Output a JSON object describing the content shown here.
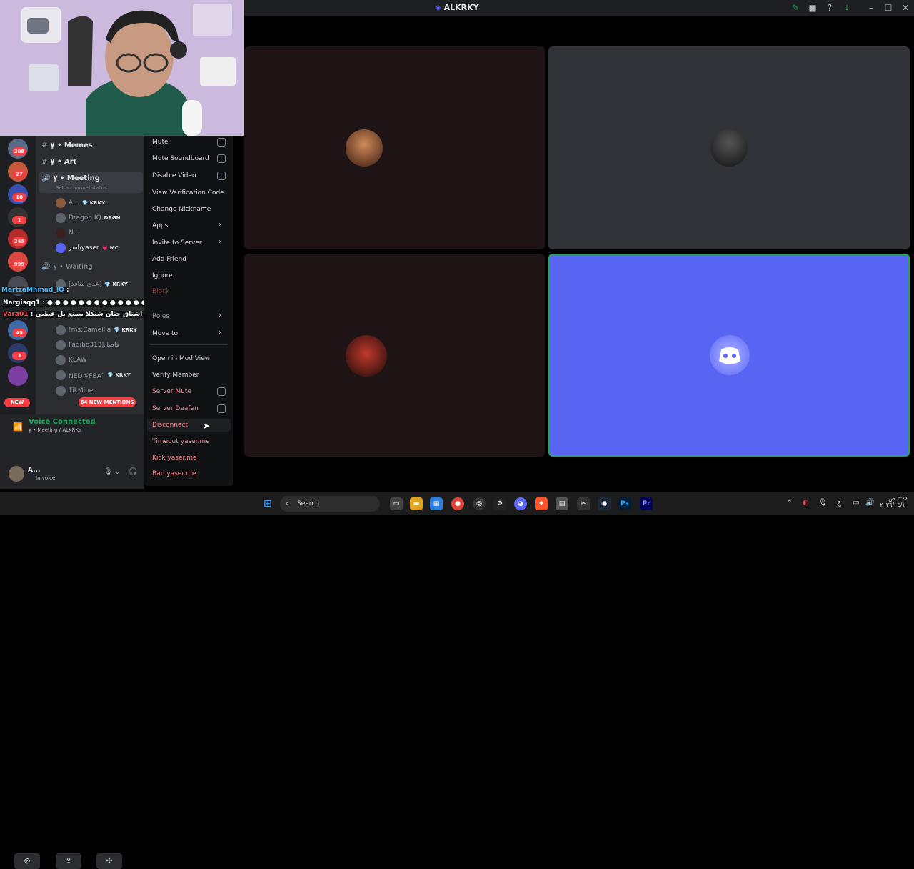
{
  "window": {
    "title": "ALKRKY"
  },
  "servers": {
    "badges": [
      "208",
      "27",
      "18",
      "1",
      "245",
      "995",
      "45",
      "3"
    ],
    "new_label": "NEW"
  },
  "channels": {
    "memes": "ٍ۷ • Memes",
    "art": "ٍ۷ • Art",
    "meeting": "ٍ۷ • Meeting",
    "meeting_status": "Set a channel status",
    "waiting": "ٍ۷ • Waiting",
    "users": [
      {
        "name": "A...",
        "tag": "💎 KRKY"
      },
      {
        "name": "Dragon IQ",
        "tag": "DRGN"
      },
      {
        "name": "N...",
        "tag": ""
      },
      {
        "name": "ياسرyaser",
        "tag": "💗 MC"
      }
    ],
    "waiting_users": [
      {
        "name": "[عدي منافذ]",
        "tag": "💎 KRKY"
      },
      {
        "name": "!ms:Camellia",
        "tag": "💎 KRKY"
      },
      {
        "name": "Fadibo313|فاضل",
        "tag": ""
      },
      {
        "name": "KLAW",
        "tag": ""
      },
      {
        "name": "NED〆FBA`",
        "tag": "💎 KRKY"
      },
      {
        "name": "TikMiner",
        "tag": ""
      }
    ]
  },
  "overlay_chat": [
    {
      "user": "MartzaMhmad_IQ",
      "text": ":"
    },
    {
      "user": "Nargisqq1",
      "text": ": ● ● ● ● ● ● ● ● ● ● ● ● ●"
    },
    {
      "user": "Vara01",
      "text": ": زين تكمل بوكتو اشتاق جنان شنكلا يصنع بل عطبي"
    }
  ],
  "mentions_label": "64 NEW MENTIONS",
  "voice": {
    "status": "Voice Connected",
    "location": "ٍ۷ • Meeting / ALKRKY",
    "user_name": "A...",
    "user_status": "In voice"
  },
  "context_menu": {
    "items": [
      {
        "label": "Mute",
        "kind": "check"
      },
      {
        "label": "Mute Soundboard",
        "kind": "check"
      },
      {
        "label": "Disable Video",
        "kind": "check"
      },
      {
        "label": "View Verification Code",
        "kind": "plain"
      },
      {
        "label": "Change Nickname",
        "kind": "plain"
      },
      {
        "label": "Apps",
        "kind": "submenu"
      },
      {
        "label": "Invite to Server",
        "kind": "submenu"
      },
      {
        "label": "Add Friend",
        "kind": "plain"
      },
      {
        "label": "Ignore",
        "kind": "plain"
      },
      {
        "label": "Block",
        "kind": "danger"
      },
      {
        "label": "Roles",
        "kind": "submenu"
      },
      {
        "label": "Move to",
        "kind": "submenu"
      },
      {
        "label": "Open in Mod View",
        "kind": "plain"
      },
      {
        "label": "Verify Member",
        "kind": "plain"
      },
      {
        "label": "Server Mute",
        "kind": "danger-check"
      },
      {
        "label": "Server Deafen",
        "kind": "danger-check"
      },
      {
        "label": "Disconnect",
        "kind": "danger"
      },
      {
        "label": "Timeout yaser.me",
        "kind": "danger"
      },
      {
        "label": "Kick yaser.me",
        "kind": "danger"
      },
      {
        "label": "Ban yaser.me",
        "kind": "danger"
      }
    ]
  },
  "taskbar": {
    "search_placeholder": "Search",
    "clock_time": "٣:٤٤ ص",
    "clock_date": "٢٠٢٦/٠٤/١٠",
    "lang": "ع"
  },
  "colors": {
    "accent": "#5865f2",
    "danger": "#f23f43",
    "voice_green": "#23a55a"
  }
}
